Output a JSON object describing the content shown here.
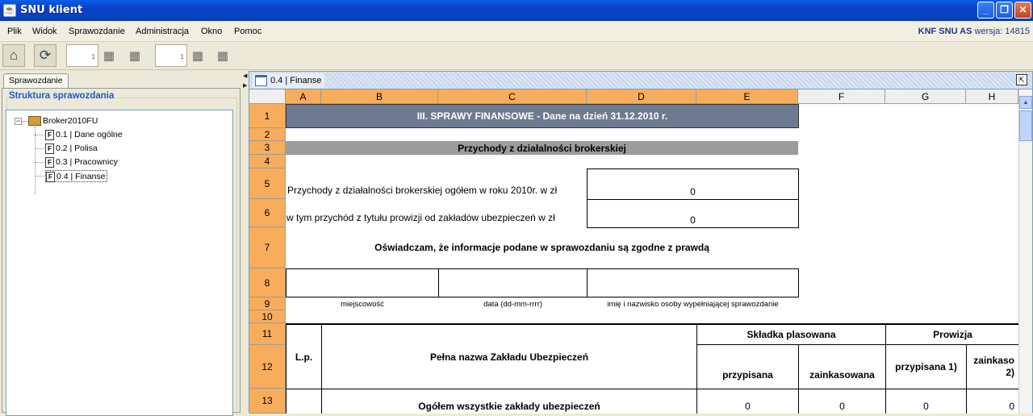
{
  "window": {
    "title": "SNU klient",
    "icon": "java-cup-icon",
    "minimize": "_",
    "maximize": "❐",
    "close": "✕"
  },
  "menu": [
    {
      "label": "Plik"
    },
    {
      "label": "Widok"
    },
    {
      "label": "Sprawozdanie"
    },
    {
      "label": "Administracja"
    },
    {
      "label": "Okno"
    },
    {
      "label": "Pomoc"
    }
  ],
  "version": {
    "brand": "KNF SNU AS",
    "text": " wersja: 14815"
  },
  "toolbar": {
    "page1": "1",
    "page2": "1"
  },
  "left": {
    "tab": "Sprawozdanie",
    "group_title": "Struktura sprawozdania",
    "root": "Broker2010FU",
    "file_glyph": "F",
    "items": [
      "0.1 | Dane ogólne",
      "0.2 | Polisa",
      "0.3 | Pracownicy",
      "0.4 | Finanse"
    ],
    "selected": "0.4 | Finanse"
  },
  "document": {
    "title": "0.4 | Finanse"
  },
  "sheet": {
    "columns": [
      "A",
      "B",
      "C",
      "D",
      "E",
      "F",
      "G",
      "H"
    ],
    "rows": [
      "1",
      "2",
      "3",
      "4",
      "5",
      "6",
      "7",
      "8",
      "9",
      "10",
      "11",
      "12",
      "13"
    ],
    "title": "III. SPRAWY FINANSOWE - Dane na dzień 31.12.2010 r.",
    "section": "Przychody z działalności brokerskiej",
    "row5_label": "Przychody z działalności brokerskiej ogółem w roku 2010r. w zł",
    "row5_value": "0",
    "row6_label": "w tym przychód z tytułu prowizji od zakładów ubezpieczeń w zł",
    "row6_value": "0",
    "declaration": "Oświadczam, że informacje podane w sprawozdaniu są zgodne z prawdą",
    "place_label": "miejscowość",
    "date_label": "data (dd-mm-rrrr)",
    "person_label": "imię i nazwisko osoby wypełniającej sprawozdanie",
    "lp": "L.p.",
    "insurer_name": "Pełna nazwa Zakładu Ubezpieczeń",
    "premium": "Składka plasowana",
    "commission": "Prowizja",
    "assigned": "przypisana",
    "collected": "zainkasowana",
    "assigned1": "przypisana 1)",
    "collected2": "zainkaso 2)",
    "total_label": "Ogółem wszystkie zakłady ubezpieczeń",
    "total_values": [
      "0",
      "0",
      "0",
      "0"
    ]
  }
}
